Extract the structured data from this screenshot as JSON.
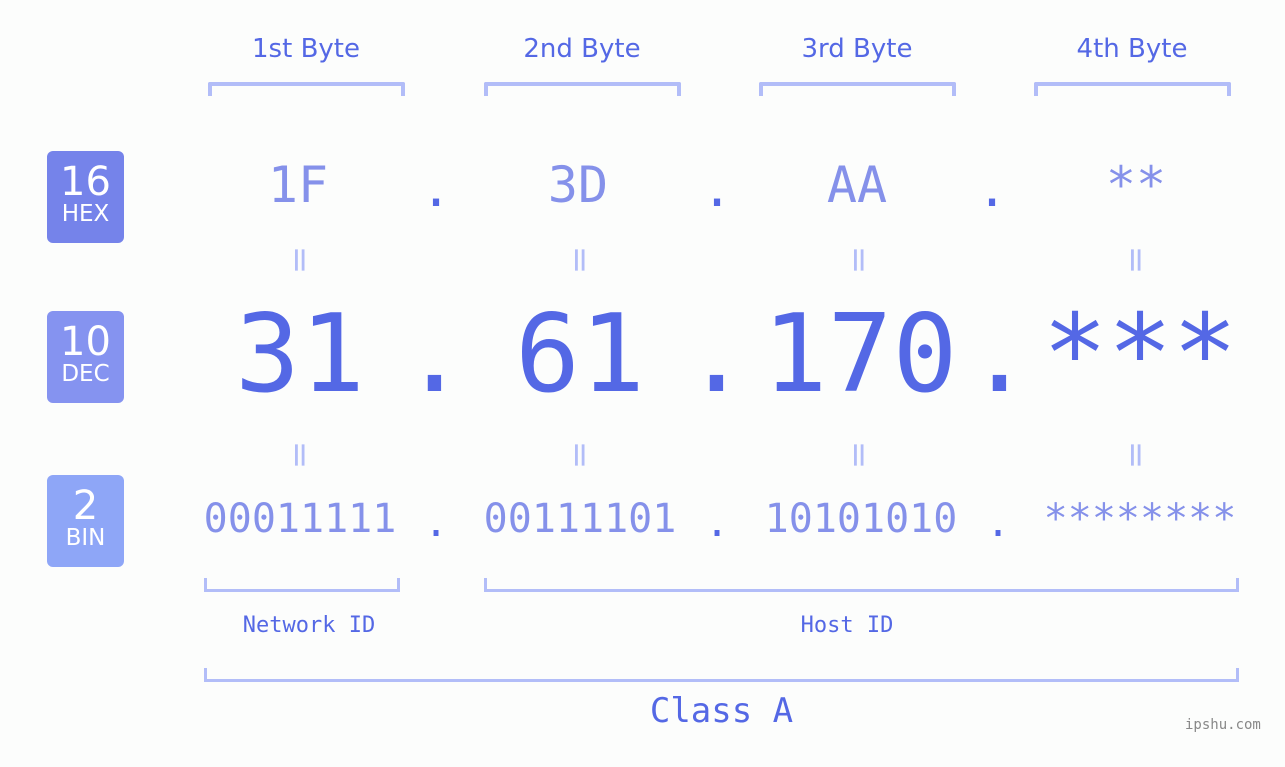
{
  "colors": {
    "accent": "#5468e5",
    "light_value": "#8591ea",
    "bracket": "#b2bdf8",
    "hex_badge": "#7583ea",
    "dec_badge": "#8593f0",
    "bin_badge": "#8ea6f7",
    "background": "#fcfdfc"
  },
  "headers": [
    "1st Byte",
    "2nd Byte",
    "3rd Byte",
    "4th Byte"
  ],
  "badges": {
    "hex": {
      "number": "16",
      "label": "HEX"
    },
    "dec": {
      "number": "10",
      "label": "DEC"
    },
    "bin": {
      "number": "2",
      "label": "BIN"
    }
  },
  "hex": [
    "1F",
    "3D",
    "AA",
    "**"
  ],
  "dec": [
    "31",
    "61",
    "170",
    "***"
  ],
  "bin": [
    "00011111",
    "00111101",
    "10101010",
    "********"
  ],
  "separator": ".",
  "equals": "=",
  "network_id_label": "Network ID",
  "host_id_label": "Host ID",
  "class_label": "Class A",
  "watermark": "ipshu.com"
}
